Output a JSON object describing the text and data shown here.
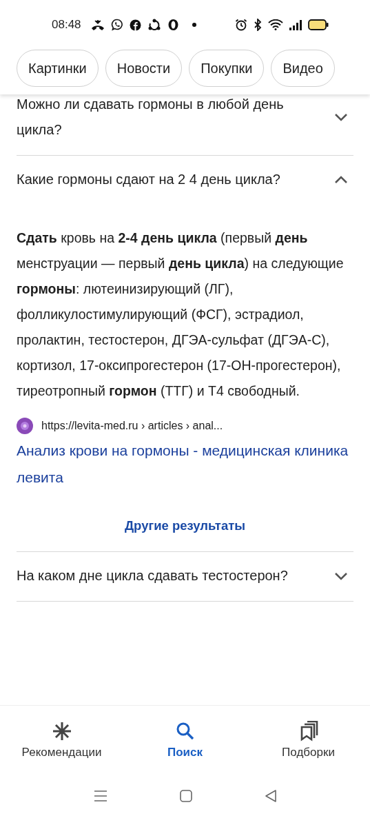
{
  "status_bar": {
    "time": "08:48"
  },
  "chips": [
    {
      "label": "Картинки"
    },
    {
      "label": "Новости"
    },
    {
      "label": "Покупки"
    },
    {
      "label": "Видео"
    }
  ],
  "faq": [
    {
      "question": "Можно ли сдавать гормоны в любой день цикла?",
      "expanded": false
    },
    {
      "question": "Какие гормоны сдают на 2 4 день цикла?",
      "expanded": true,
      "answer": "**Сдать** кровь на **2-4 день цикла** (первый **день** менструации — первый **день цикла**) на следующие **гормоны**: лютеинизирующий (ЛГ), фолликулостимулирующий (ФСГ), эстрадиол, пролактин, тестостерон, ДГЭА-сульфат (ДГЭА-С), кортизол, 17-оксипрогестерон (17-ОН-прогестерон), тиреотропный **гормон** (ТТГ) и Т4 свободный.",
      "source_url": "https://levita-med.ru › articles › anal...",
      "source_title": "Анализ крови на гормоны - медицинская клиника левита",
      "more_link": "Другие результаты"
    },
    {
      "question": "На каком дне цикла сдавать тестостерон?",
      "expanded": false
    }
  ],
  "bottom_nav": [
    {
      "label": "Рекомендации",
      "selected": false
    },
    {
      "label": "Поиск",
      "selected": true
    },
    {
      "label": "Подборки",
      "selected": false
    }
  ]
}
